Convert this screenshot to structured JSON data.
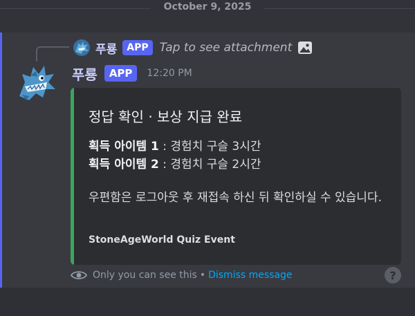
{
  "date_divider": "October 9, 2025",
  "reply": {
    "author": "푸룡",
    "badge": "APP",
    "text": "Tap to see attachment",
    "attachment_icon": "image-icon"
  },
  "message": {
    "author": "푸룡",
    "badge": "APP",
    "timestamp": "12:20 PM",
    "avatar_icon": "dragon-avatar",
    "embed": {
      "accent_color": "#3ba55c",
      "title": "정답 확인 · 보상 지급 완료",
      "fields": [
        {
          "name": "획득 아이템 1",
          "separator": " : ",
          "value": "경험치 구슬 3시간"
        },
        {
          "name": "획득 아이템 2",
          "separator": " : ",
          "value": "경험치 구슬 2시간"
        }
      ],
      "description": "우편함은 로그아웃 후 재접속 하신 뒤 확인하실 수 있습니다.",
      "footer": "StoneAgeWorld Quiz Event"
    }
  },
  "ephemeral": {
    "notice": "Only you can see this",
    "dot": "•",
    "dismiss_label": "Dismiss message"
  },
  "help": {
    "label": "?"
  },
  "colors": {
    "brand": "#5865f2",
    "link": "#00a8fc",
    "embed_bar": "#3ba55c"
  }
}
